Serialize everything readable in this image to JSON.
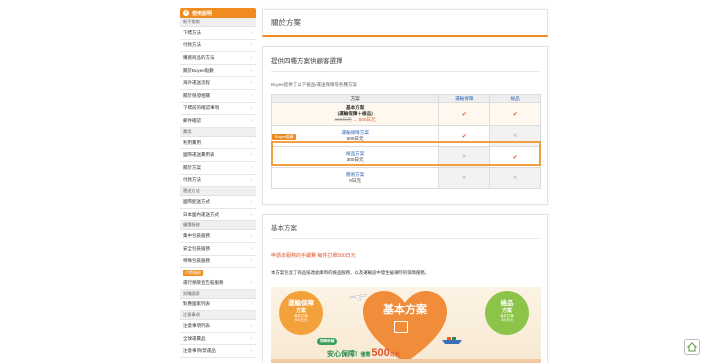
{
  "sidebar": {
    "header_label": "使用說明",
    "header_icon": "question-icon",
    "sections": [
      {
        "label": "新手指南",
        "items": [
          "下標方法",
          "付款方法",
          "購買商品的方法",
          "關於Buyee點數",
          "海外運送流程",
          "關於保證相關",
          "下標前的確認事項",
          "郵件確認"
        ]
      },
      {
        "label": "費用",
        "items": [
          "利用費用",
          "國際運送費用表",
          "關於方案",
          "付款方法"
        ]
      },
      {
        "label": "運送方法",
        "items": [
          "國際配送方式",
          "日本國內運送方式"
        ]
      },
      {
        "label": "優惠服務",
        "items": [
          "集中包裝服務",
          "安全包裝服務",
          "特殊包裝服務"
        ]
      }
    ],
    "badge_label": "付費服務",
    "badge_item": "運行保險宣告裝服務",
    "sections_after": [
      {
        "label": "對應國家",
        "items": [
          "對應國家列表"
        ]
      },
      {
        "label": "注意事項",
        "items": [
          "注意事項列表",
          "全球運費品",
          "注意事項/禁運品"
        ]
      }
    ]
  },
  "main": {
    "page_title": "關於方案",
    "plans": {
      "heading": "提供四種方案供顧客選擇",
      "intro": "Buyee提供了以下檢品/運送保障等各種方案",
      "columns": [
        "方案",
        "運輸保障",
        "檢品"
      ],
      "recommended_tag": "Buyee推薦",
      "rows": [
        {
          "name_line1": "基本方案",
          "name_line2": "(運輸保障＋檢品)",
          "old_price": "800日元",
          "arrow": "→",
          "new_price": "500日元",
          "safe": "check",
          "inspect": "check"
        },
        {
          "name_line1": "運輸保障方案",
          "price": "500日元",
          "safe": "check",
          "inspect": "cross"
        },
        {
          "name_line1": "檢品方案",
          "price": "300日元",
          "safe": "cross",
          "inspect": "check"
        },
        {
          "name_line1": "簡易方案",
          "price": "0日元",
          "safe": "cross",
          "inspect": "cross"
        }
      ]
    },
    "basic": {
      "heading": "基本方案",
      "red_note": "申請本服務的手續費 每件訂單500日元",
      "note": "本方案包含了商品抵達倉庫時的檢品服務，以及運輸途中發生破損時的保障服務。",
      "banner": {
        "left_circle": {
          "line1": "運輸保障",
          "line2": "方案",
          "line3": "每件訂單",
          "line4": "500日元"
        },
        "center_title": "基本方案",
        "right_circle": {
          "line1": "檢品",
          "line2": "方案",
          "line3": "每件訂單",
          "line4": "300日元"
        },
        "sticker": "同時申請",
        "slogan": "安心保障!",
        "slogan_small": "僅需",
        "slogan_price": "500",
        "slogan_unit": "日元"
      }
    }
  },
  "colors": {
    "accent": "#f08c1f",
    "link": "#2a62b8",
    "check": "#e25a2a",
    "banner_heart": "#f08c3a",
    "banner_green": "#8cc44a"
  },
  "fab_icon": "home-icon"
}
